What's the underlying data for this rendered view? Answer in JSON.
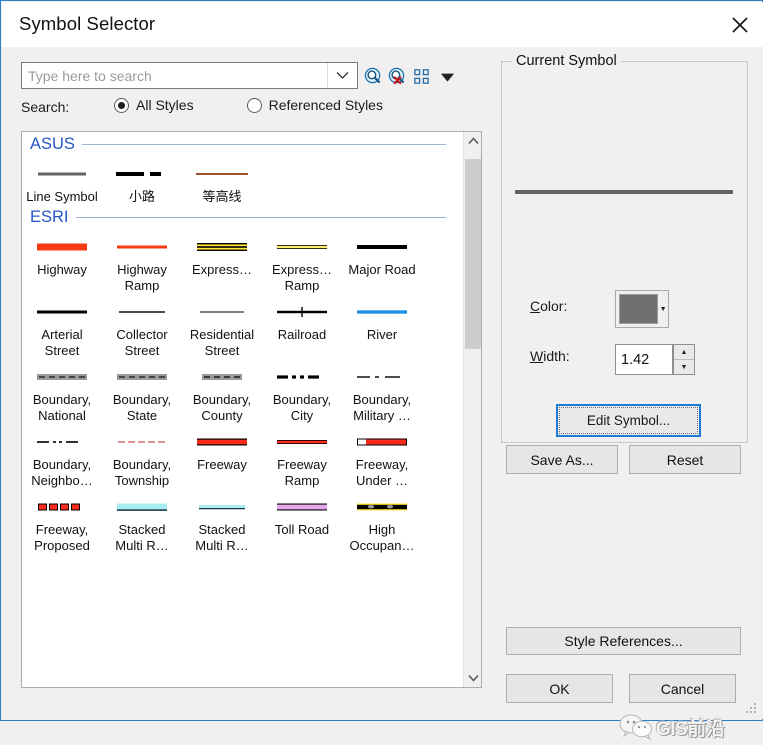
{
  "window": {
    "title": "Symbol Selector",
    "close_icon": "close-icon"
  },
  "search": {
    "placeholder": "Type here to search",
    "value": "",
    "dropdown_icon": "chevron-down-icon",
    "tool_icons": [
      "search-icon",
      "clear-search-icon",
      "view-mode-icon",
      "view-mode-dropdown-icon"
    ],
    "label": "Search:",
    "options": [
      {
        "label": "All Styles",
        "selected": true
      },
      {
        "label": "Referenced Styles",
        "selected": false
      }
    ]
  },
  "symbol_list": {
    "scroll_up_icon": "chevron-up-icon",
    "scroll_down_icon": "chevron-down-icon",
    "groups": [
      {
        "name": "ASUS",
        "symbols": [
          {
            "label": "Line Symbol",
            "style": "gray-solid",
            "color": "#636363"
          },
          {
            "label": "小路",
            "style": "black-dashed",
            "color": "#000000"
          },
          {
            "label": "等高线",
            "style": "brown-solid",
            "color": "#a0522d"
          }
        ]
      },
      {
        "name": "ESRI",
        "symbols": [
          {
            "label": "Highway",
            "style": "thick-red",
            "color": "#f93b11"
          },
          {
            "label": "Highway Ramp",
            "style": "medium-red",
            "color": "#f93b11"
          },
          {
            "label": "Express…",
            "style": "yellow-double-casing",
            "color": "#ffe536"
          },
          {
            "label": "Express… Ramp",
            "style": "yellow-thin-casing",
            "color": "#ffec6e"
          },
          {
            "label": "Major Road",
            "style": "thick-black",
            "color": "#000000"
          },
          {
            "label": "Arterial Street",
            "style": "medium-black",
            "color": "#000000"
          },
          {
            "label": "Collector Street",
            "style": "thin-black",
            "color": "#000000"
          },
          {
            "label": "Residential Street",
            "style": "hairline-black",
            "color": "#000000"
          },
          {
            "label": "Railroad",
            "style": "railroad-tick",
            "color": "#000000"
          },
          {
            "label": "River",
            "style": "blue-solid",
            "color": "#1e90e8"
          },
          {
            "label": "Boundary, National",
            "style": "gray-band-dash",
            "color": "#9a9a9a"
          },
          {
            "label": "Boundary, State",
            "style": "gray-band-dash",
            "color": "#9a9a9a"
          },
          {
            "label": "Boundary, County",
            "style": "gray-band-dash-short",
            "color": "#9a9a9a"
          },
          {
            "label": "Boundary, City",
            "style": "black-dash-dot-thick",
            "color": "#000000"
          },
          {
            "label": "Boundary, Military …",
            "style": "black-dash-dot-thin",
            "color": "#000000"
          },
          {
            "label": "Boundary, Neighbo…",
            "style": "black-dash-dotdot",
            "color": "#000000"
          },
          {
            "label": "Boundary, Township",
            "style": "red-dashed-thin",
            "color": "#d4646e"
          },
          {
            "label": "Freeway",
            "style": "red-thick-outline",
            "color": "#fc2c1c"
          },
          {
            "label": "Freeway Ramp",
            "style": "red-medium-outline",
            "color": "#fc2c1c"
          },
          {
            "label": "Freeway, Under …",
            "style": "red-box-white-gap",
            "color": "#fc2c1c"
          },
          {
            "label": "Freeway, Proposed",
            "style": "red-dash-blocks",
            "color": "#fc2c1c"
          },
          {
            "label": "Stacked Multi R…",
            "style": "cyan-thick-underline",
            "color": "#a9ecf2"
          },
          {
            "label": "Stacked Multi R…",
            "style": "cyan-thin-underline",
            "color": "#a9ecf2"
          },
          {
            "label": "Toll Road",
            "style": "violet-outline",
            "color": "#e8a6ec"
          },
          {
            "label": "High Occupan…",
            "style": "yellow-black-markers",
            "color": "#ffe536"
          }
        ]
      }
    ]
  },
  "current_symbol": {
    "group_title": "Current Symbol",
    "preview_color": "#636363",
    "color_label": "Color:",
    "color_value": "#707070",
    "color_dropdown_icon": "triangle-down-icon",
    "width_label": "Width:",
    "width_value": "1.42",
    "spinner_up_icon": "triangle-up-icon",
    "spinner_down_icon": "triangle-down-icon",
    "edit_symbol_label": "Edit Symbol...",
    "save_as_label": "Save As...",
    "reset_label": "Reset"
  },
  "footer": {
    "style_references_label": "Style References...",
    "ok_label": "OK",
    "cancel_label": "Cancel",
    "watermark_text": "GIS前沿",
    "watermark_icon": "wechat-icon"
  }
}
